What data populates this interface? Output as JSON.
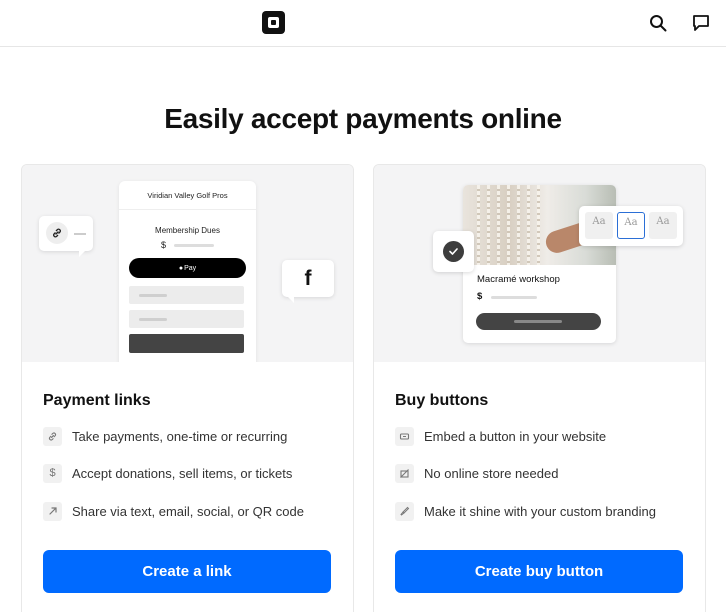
{
  "header": {
    "logo": "square-logo",
    "search_icon": "search-icon",
    "chat_icon": "chat-icon"
  },
  "page": {
    "title": "Easily accept payments online"
  },
  "cards": [
    {
      "id": "payment-links",
      "heading": "Payment links",
      "illustration": {
        "business_name": "Viridian Valley Golf Pros",
        "item": "Membership Dues",
        "currency": "$",
        "pay_label": "Pay",
        "social_icon": "facebook-icon",
        "link_icon": "link-icon"
      },
      "features": [
        {
          "icon": "link-icon",
          "text": "Take payments, one-time or recurring"
        },
        {
          "icon": "dollar-icon",
          "text": "Accept donations, sell items, or tickets"
        },
        {
          "icon": "arrow-up-right-icon",
          "text": "Share via text, email, social, or QR code"
        }
      ],
      "cta": "Create a link"
    },
    {
      "id": "buy-buttons",
      "heading": "Buy buttons",
      "illustration": {
        "product_name": "Macramé workshop",
        "currency": "$",
        "font_options": [
          "Aa",
          "Aa",
          "Aa"
        ],
        "selected_font_index": 1,
        "check_icon": "check-icon"
      },
      "features": [
        {
          "icon": "button-icon",
          "text": "Embed a button in your website"
        },
        {
          "icon": "no-store-icon",
          "text": "No online store needed"
        },
        {
          "icon": "paintbrush-icon",
          "text": "Make it shine with your custom branding"
        }
      ],
      "cta": "Create buy button"
    }
  ],
  "colors": {
    "accent": "#006aff",
    "dark": "#111111",
    "illustration_bg": "#f4f4f5"
  }
}
